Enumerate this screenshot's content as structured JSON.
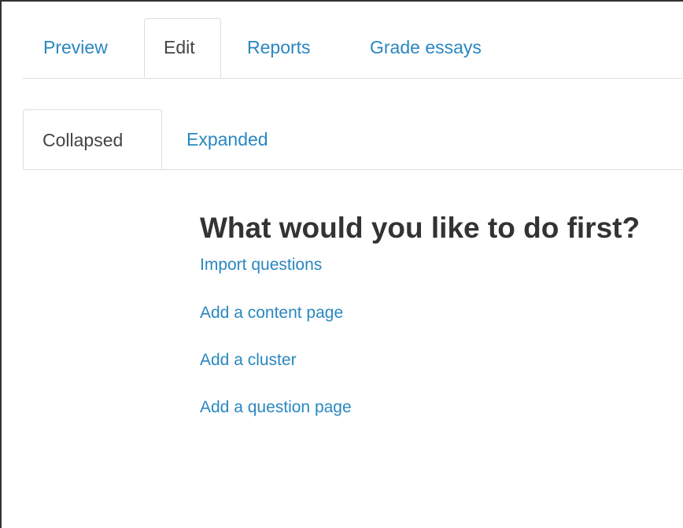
{
  "primary_tabs": [
    {
      "label": "Preview",
      "active": false
    },
    {
      "label": "Edit",
      "active": true
    },
    {
      "label": "Reports",
      "active": false
    },
    {
      "label": "Grade essays",
      "active": false
    }
  ],
  "secondary_tabs": [
    {
      "label": "Collapsed",
      "active": true
    },
    {
      "label": "Expanded",
      "active": false
    }
  ],
  "main": {
    "heading": "What would you like to do first?",
    "links": [
      "Import questions",
      "Add a content page",
      "Add a cluster",
      "Add a question page"
    ]
  },
  "colors": {
    "link": "#2a87c0",
    "active_tab_text": "#444444",
    "heading": "#333333",
    "border": "#dddddd"
  }
}
